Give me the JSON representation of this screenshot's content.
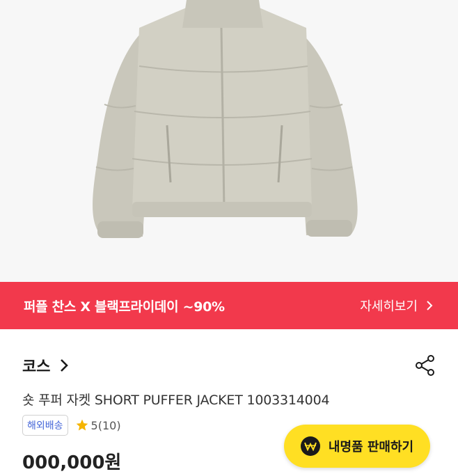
{
  "promo": {
    "text": "퍼플 찬스 X 블랙프라이데이 ~90%",
    "link_label": "자세히보기"
  },
  "product": {
    "brand": "코스",
    "title": "숏 푸퍼 자켓 SHORT PUFFER JACKET 1003314004",
    "shipping_badge": "해외배송",
    "rating": "5(10)",
    "price": "000,000원"
  },
  "sell_button": {
    "label": "내명품 판매하기"
  },
  "colors": {
    "promo_bg": "#f2394c",
    "sell_button_bg": "#ffdf23",
    "badge_text": "#4566d8",
    "star": "#f5b400",
    "jacket": "#cfcdc1"
  },
  "icons": [
    "jacket-image",
    "chevron-right-icon",
    "share-icon",
    "star-icon",
    "won-coin-icon"
  ]
}
